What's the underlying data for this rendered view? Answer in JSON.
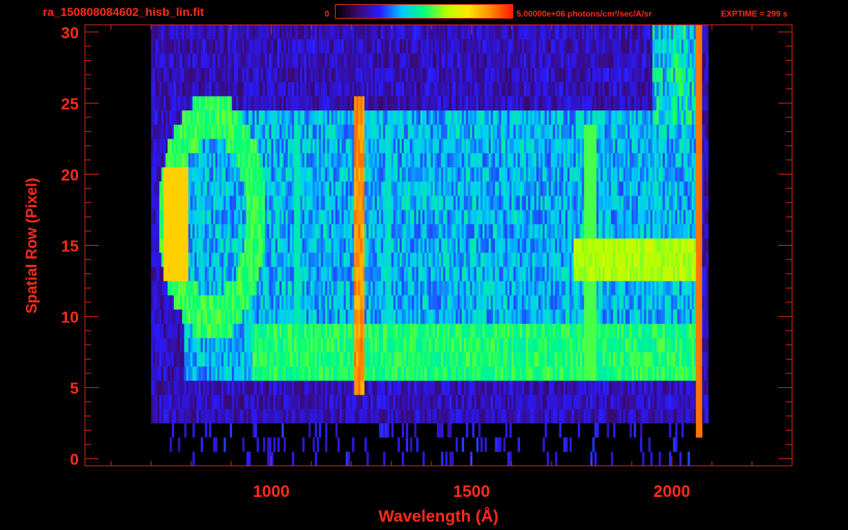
{
  "header": {
    "title": "ra_150808084602_hisb_lin.fit",
    "colorbar_min": "0",
    "colorbar_max": "5.00000e+06 photons/cm²/sec/A/sr",
    "exptime": "EXPTIME = 299 s"
  },
  "colors": {
    "axis": "#ff2a1a",
    "background": "#000000",
    "colormap": [
      "#000000",
      "#3a0a6e",
      "#2a1aff",
      "#00c8ff",
      "#00ff7a",
      "#b4ff00",
      "#ffe600",
      "#ff8c00",
      "#ff1a00"
    ]
  },
  "chart_data": {
    "type": "heatmap",
    "title": "ra_150808084602_hisb_lin.fit",
    "xlabel": "Wavelength (Å)",
    "ylabel": "Spatial Row (Pixel)",
    "xlim": [
      535,
      2300
    ],
    "ylim": [
      -0.5,
      30.5
    ],
    "x_ticks": [
      1000,
      1500,
      2000
    ],
    "y_ticks": [
      0,
      5,
      10,
      15,
      20,
      25,
      30
    ],
    "colorbar": {
      "min": 0,
      "max": 5000000,
      "unit": "photons/cm²/sec/A/sr"
    },
    "data_extent": {
      "x": [
        700,
        2090
      ],
      "y": [
        0,
        30
      ]
    },
    "features": [
      {
        "name": "Lyman-alpha emission line",
        "wavelength": 1216,
        "rows": [
          5,
          25
        ]
      },
      {
        "name": "upper bright band",
        "rows": [
          6,
          9
        ],
        "wavelength_range": [
          950,
          2060
        ]
      },
      {
        "name": "lower spectrum band",
        "rows": [
          13,
          15
        ],
        "wavelength_range": [
          1750,
          2060
        ]
      },
      {
        "name": "long-wavelength cutoff",
        "wavelength": 2065
      }
    ]
  }
}
